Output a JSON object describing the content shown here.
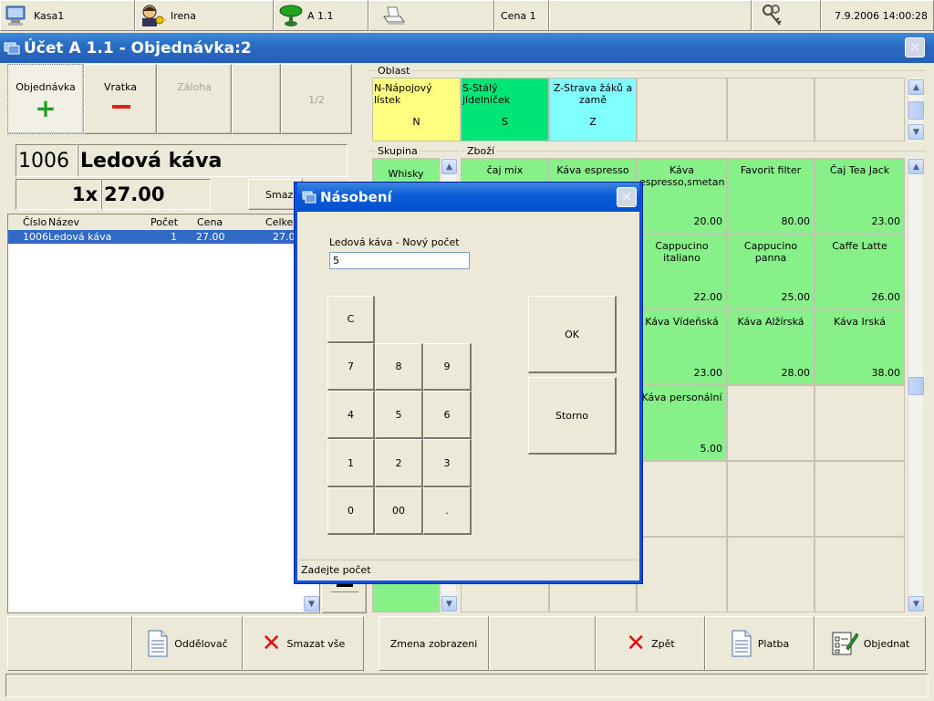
{
  "topbar": {
    "terminal": "Kasa1",
    "user": "Irena",
    "table": "A 1.1",
    "price_level": "Cena 1",
    "datetime": "7.9.2006 14:00:28"
  },
  "window": {
    "title": "Účet A 1.1 - Objednávka:2"
  },
  "order_buttons": {
    "order": "Objednávka",
    "refund": "Vratka",
    "deposit": "Záloha",
    "page": "1/2"
  },
  "selected_item": {
    "code": "1006",
    "name": "Ledová káva",
    "quantity": "1x",
    "price": "27.00",
    "delete_button": "Smazat"
  },
  "order_table": {
    "columns": [
      "Číslo",
      "Název",
      "Počet",
      "Cena",
      "Celkem"
    ],
    "rows": [
      {
        "code": "1006",
        "name": "Ledová káva",
        "qty": "1",
        "price": "27.00",
        "total": "27.00"
      }
    ]
  },
  "area": {
    "label": "Oblast",
    "items": [
      {
        "name": "N-Nápojový lístek",
        "key": "N",
        "color": "#FFFF80"
      },
      {
        "name": "S-Stálý jídelníček",
        "key": "S",
        "color": "#00E676"
      },
      {
        "name": "Z-Strava žáků a zamě",
        "key": "Z",
        "color": "#80FFFF"
      }
    ]
  },
  "group": {
    "label": "Skupina",
    "items": [
      "Whisky"
    ]
  },
  "goods": {
    "label": "Zboží",
    "items": [
      {
        "name": "čaj mix",
        "price": ""
      },
      {
        "name": "Káva espresso",
        "price": ""
      },
      {
        "name": "Káva espresso,smetan",
        "price": "20.00"
      },
      {
        "name": "Favorit filter",
        "price": "80.00"
      },
      {
        "name": "Čaj Tea Jack",
        "price": "23.00"
      },
      {
        "name": "Cappucino italiano",
        "price": "22.00"
      },
      {
        "name": "Cappucino panna",
        "price": "25.00"
      },
      {
        "name": "Caffe Latte",
        "price": "26.00"
      },
      {
        "name": "Káva Vídeňská",
        "price": "23.00"
      },
      {
        "name": "Káva Alžírská",
        "price": "28.00"
      },
      {
        "name": "Káva Irská",
        "price": "38.00"
      },
      {
        "name": "Káva personální",
        "price": "5.00"
      }
    ]
  },
  "dialog": {
    "title": "Násobení",
    "prompt": "Ledová káva - Nový počet",
    "value": "5",
    "keys": {
      "clear": "C",
      "k7": "7",
      "k8": "8",
      "k9": "9",
      "k4": "4",
      "k5": "5",
      "k6": "6",
      "k1": "1",
      "k2": "2",
      "k3": "3",
      "k0": "0",
      "k00": "00",
      "dot": "."
    },
    "ok": "OK",
    "cancel": "Storno",
    "status": "Zadejte počet"
  },
  "bottom_bar": {
    "separator": "Oddělovač",
    "delete_all": "Smazat vše",
    "change_view": "Zmena zobrazeni",
    "back": "Zpět",
    "payment": "Platba",
    "order": "Objednat"
  }
}
